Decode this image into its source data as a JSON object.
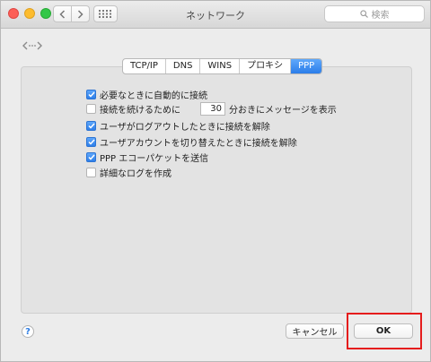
{
  "window": {
    "title": "ネットワーク",
    "search_placeholder": "検索"
  },
  "toolbar_icons": [
    "back-chevron-icon",
    "forward-chevron-icon",
    "show-all-grid-icon",
    "search-icon"
  ],
  "header_icon": "network-arrows-icon",
  "tabs": [
    {
      "label": "TCP/IP",
      "active": false
    },
    {
      "label": "DNS",
      "active": false
    },
    {
      "label": "WINS",
      "active": false
    },
    {
      "label": "プロキシ",
      "active": false
    },
    {
      "label": "PPP",
      "active": true
    }
  ],
  "options": {
    "auto_connect": {
      "label": "必要なときに自動的に接続",
      "checked": true
    },
    "keepalive": {
      "label_before": "接続を続けるために",
      "minutes": "30",
      "label_after": "分おきにメッセージを表示",
      "checked": false
    },
    "disconnect_logout": {
      "label": "ユーザがログアウトしたときに接続を解除",
      "checked": true
    },
    "disconnect_switch": {
      "label": "ユーザアカウントを切り替えたときに接続を解除",
      "checked": true
    },
    "ppp_echo": {
      "label": "PPP エコーパケットを送信",
      "checked": true
    },
    "verbose_log": {
      "label": "詳細なログを作成",
      "checked": false
    }
  },
  "footer": {
    "help_label": "?",
    "cancel_label": "キャンセル",
    "ok_label": "OK"
  },
  "colors": {
    "accent": "#2b7de9",
    "highlight_frame": "#e51c1c"
  }
}
